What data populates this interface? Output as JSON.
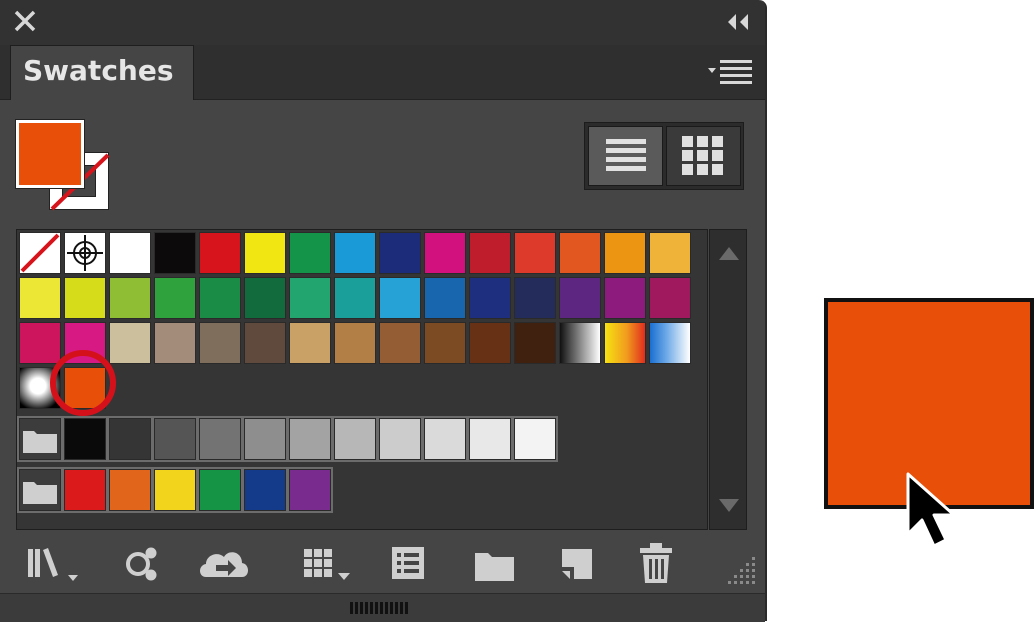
{
  "panel": {
    "tab_label": "Swatches"
  },
  "fill_color": "#e8500a",
  "selected_swatch": "#e8500a",
  "rows": [
    [
      "none",
      "registration",
      "#ffffff",
      "#0d0a0b",
      "#d7141b",
      "#f2e612",
      "#139448",
      "#1a9ad7",
      "#1d2c7a",
      "#d3117e",
      "#bf1c2c",
      "#dd3a2c",
      "#e2561f",
      "#ec9512",
      "#f0b33a"
    ],
    [
      "#ece634",
      "#d6db1a",
      "#8fbd34",
      "#2fa23e",
      "#1b8c45",
      "#126b3c",
      "#22a56f",
      "#1a9f9a",
      "#27a2d6",
      "#1866ae",
      "#1f2f80",
      "#232c5b",
      "#5d2681",
      "#8d1b7d",
      "#a0195f"
    ],
    [
      "#cc155c",
      "#d71983",
      "#ccbf9e",
      "#a48c7b",
      "#7f6e5b",
      "#604a3d",
      "#c9a166",
      "#b27f46",
      "#955d34",
      "#7c4a23",
      "#663114",
      "#40200e",
      "gradient-bw",
      "gradient-orange",
      "gradient-blue"
    ]
  ],
  "row4": [
    "gradient-radial",
    "#e8500a"
  ],
  "gray_group": [
    "#0a0a0a",
    "#353535",
    "#555555",
    "#737373",
    "#8e8e8e",
    "#a3a3a3",
    "#b7b7b7",
    "#cccccc",
    "#dadada",
    "#e8e8e8",
    "#f3f3f3"
  ],
  "bright_group": [
    "#da1a1b",
    "#e2651c",
    "#f2d41c",
    "#159446",
    "#133b8a",
    "#7a2c8e"
  ],
  "toolbar_icons": [
    "swatch-libraries-icon",
    "show-kinds-icon",
    "cloud-sync-icon",
    "show-swatch-kinds-icon",
    "swatch-options-icon",
    "new-color-group-icon",
    "new-swatch-icon",
    "delete-swatch-icon"
  ]
}
